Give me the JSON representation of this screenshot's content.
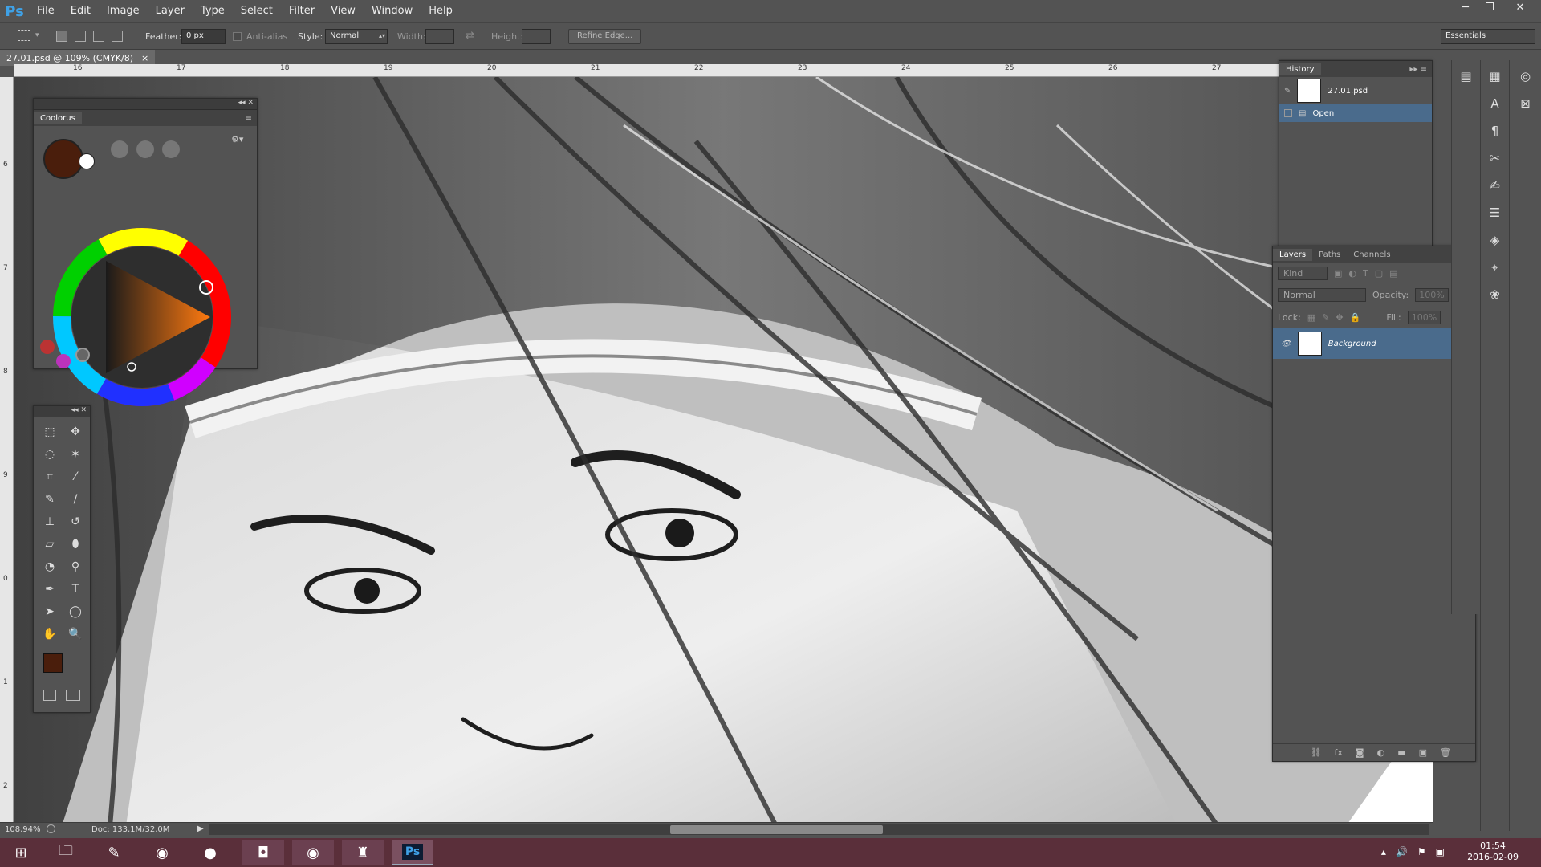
{
  "app": {
    "logo": "Ps"
  },
  "menu": [
    "File",
    "Edit",
    "Image",
    "Layer",
    "Type",
    "Select",
    "Filter",
    "View",
    "Window",
    "Help"
  ],
  "window_controls": {
    "minimize": "─",
    "restore": "❐",
    "close": "✕"
  },
  "options": {
    "feather_label": "Feather:",
    "feather_value": "0 px",
    "antialias_label": "Anti-alias",
    "style_label": "Style:",
    "style_value": "Normal",
    "width_label": "Width:",
    "height_label": "Height:",
    "refine_label": "Refine Edge...",
    "workspace": "Essentials"
  },
  "document": {
    "tab_title": "27.01.psd @ 109% (CMYK/8)",
    "close": "×"
  },
  "ruler_top": [
    "16",
    "17",
    "18",
    "19",
    "20",
    "21",
    "22",
    "23",
    "24",
    "25",
    "26",
    "27"
  ],
  "ruler_left": [
    "6",
    "7",
    "8",
    "9",
    "0",
    "1",
    "2"
  ],
  "status": {
    "zoom": "108,94%",
    "doc": "Doc: 133,1M/32,0M"
  },
  "coolorus": {
    "title": "Coolorus",
    "fg_color": "#4a1e0c",
    "bg_color": "#ffffff"
  },
  "toolbox": {
    "tools": [
      "rectangular-marquee-icon",
      "move-icon",
      "lasso-icon",
      "magic-wand-icon",
      "crop-icon",
      "eyedropper-icon",
      "healing-brush-icon",
      "brush-icon",
      "stamp-icon",
      "history-brush-icon",
      "eraser-icon",
      "paint-bucket-icon",
      "blur-icon",
      "dodge-icon",
      "pen-icon",
      "type-icon",
      "path-select-icon",
      "ellipse-icon",
      "hand-icon",
      "zoom-icon"
    ],
    "glyphs": [
      "⬚",
      "✥",
      "◌",
      "✶",
      "⌗",
      "⁄",
      "✎",
      "/",
      "⊥",
      "↺",
      "▱",
      "⬮",
      "◔",
      "⚲",
      "✒",
      "T",
      "➤",
      "◯",
      "✋",
      "🔍"
    ]
  },
  "history": {
    "title": "History",
    "items": [
      {
        "label": "27.01.psd",
        "kind": "snapshot"
      },
      {
        "label": "Open",
        "kind": "step"
      }
    ]
  },
  "layers": {
    "tabs": [
      "Layers",
      "Paths",
      "Channels"
    ],
    "kind_label": "Kind",
    "blend_mode": "Normal",
    "opacity_label": "Opacity:",
    "opacity_value": "100%",
    "lock_label": "Lock:",
    "fill_label": "Fill:",
    "fill_value": "100%",
    "items": [
      {
        "name": "Background",
        "locked": true,
        "visible": true
      }
    ]
  },
  "taskbar": {
    "apps": [
      "windows-start-icon",
      "file-explorer-icon",
      "pen-app-icon",
      "chrome-icon",
      "firefox-icon",
      "media-app-icon",
      "chrome-icon",
      "world-of-tanks-icon",
      "photoshop-icon"
    ],
    "ps_label": "Ps",
    "time": "01:54",
    "date": "2016-02-09"
  },
  "colors": {
    "accent": "#3fa1e6",
    "layer_selected": "#4a6b8c",
    "taskbar": "#5a2f3a"
  }
}
